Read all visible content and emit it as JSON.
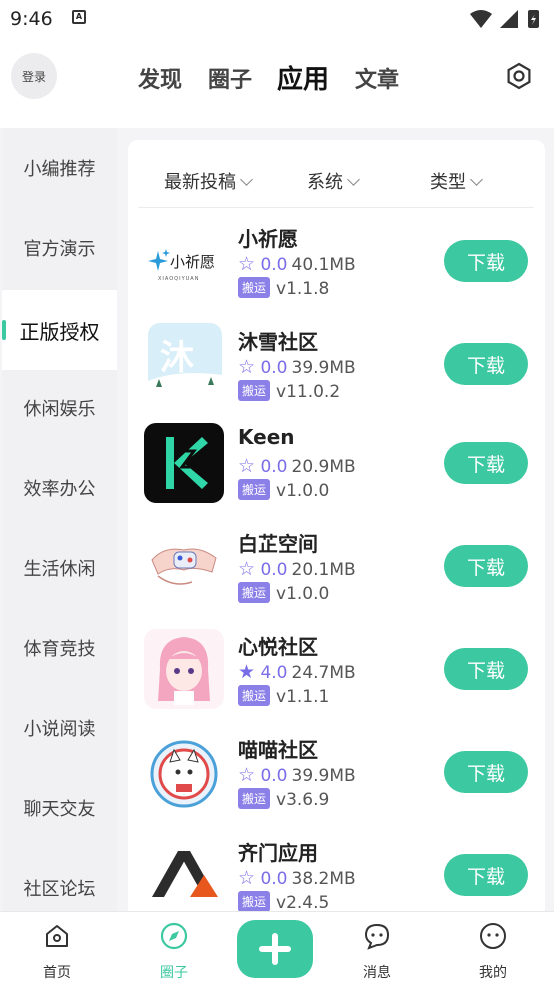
{
  "status": {
    "time": "9:46",
    "notif_icon": "A"
  },
  "header": {
    "login": "登录",
    "tabs": [
      {
        "label": "发现"
      },
      {
        "label": "圈子"
      },
      {
        "label": "应用"
      },
      {
        "label": "文章"
      }
    ],
    "active_tab": "应用"
  },
  "sidebar": {
    "items": [
      {
        "label": "小编推荐"
      },
      {
        "label": "官方演示"
      },
      {
        "label": "正版授权"
      },
      {
        "label": "休闲娱乐"
      },
      {
        "label": "效率办公"
      },
      {
        "label": "生活休闲"
      },
      {
        "label": "体育竞技"
      },
      {
        "label": "小说阅读"
      },
      {
        "label": "聊天交友"
      },
      {
        "label": "社区论坛"
      }
    ],
    "active": "正版授权"
  },
  "filters": [
    {
      "label": "最新投稿"
    },
    {
      "label": "系统"
    },
    {
      "label": "类型"
    }
  ],
  "apps": [
    {
      "name": "小祈愿",
      "rating": "0.0",
      "size": "40.1MB",
      "tag": "搬运",
      "version": "v1.1.8",
      "button": "下载",
      "starred": false
    },
    {
      "name": "沐雪社区",
      "rating": "0.0",
      "size": "39.9MB",
      "tag": "搬运",
      "version": "v11.0.2",
      "button": "下载",
      "starred": false
    },
    {
      "name": "Keen",
      "rating": "0.0",
      "size": "20.9MB",
      "tag": "搬运",
      "version": "v1.0.0",
      "button": "下载",
      "starred": false
    },
    {
      "name": "白芷空间",
      "rating": "0.0",
      "size": "20.1MB",
      "tag": "搬运",
      "version": "v1.0.0",
      "button": "下载",
      "starred": false
    },
    {
      "name": "心悦社区",
      "rating": "4.0",
      "size": "24.7MB",
      "tag": "搬运",
      "version": "v1.1.1",
      "button": "下载",
      "starred": true
    },
    {
      "name": "喵喵社区",
      "rating": "0.0",
      "size": "39.9MB",
      "tag": "搬运",
      "version": "v3.6.9",
      "button": "下载",
      "starred": false
    },
    {
      "name": "齐门应用",
      "rating": "0.0",
      "size": "38.2MB",
      "tag": "搬运",
      "version": "v2.4.5",
      "button": "下载",
      "starred": false
    }
  ],
  "icons": {
    "app_0_logo_text": "小祈愿",
    "app_0_logo_sub": "XIAOQIYUAN",
    "app_1_logo_char": "沐"
  },
  "bottom_nav": [
    {
      "label": "首页"
    },
    {
      "label": "圈子"
    },
    {
      "label": "消息"
    },
    {
      "label": "我的"
    }
  ],
  "colors": {
    "accent": "#3cc8a0",
    "tag": "#8b7fe8",
    "star": "#7a6de8"
  }
}
